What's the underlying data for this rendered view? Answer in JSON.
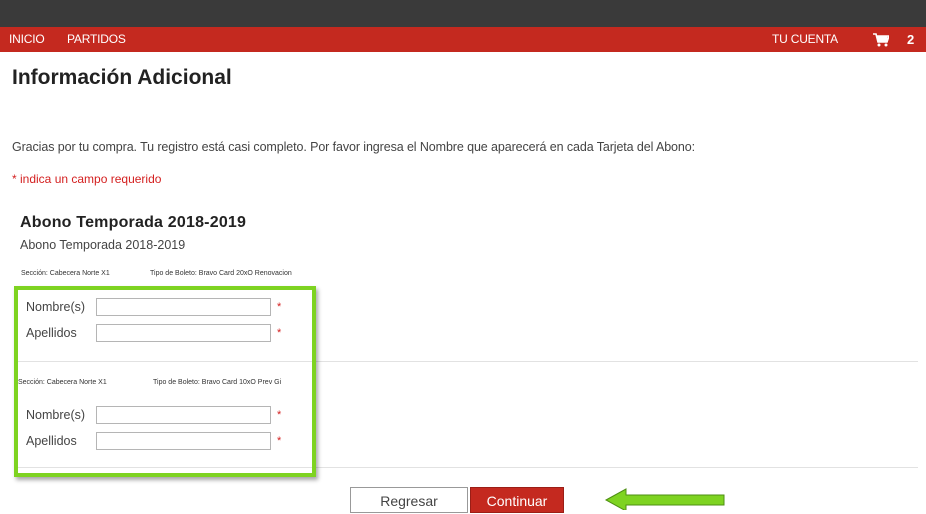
{
  "nav": {
    "inicio": "INICIO",
    "partidos": "PARTIDOS",
    "cuenta": "TU CUENTA",
    "cart_count": "2"
  },
  "page": {
    "title": "Información Adicional",
    "intro": "Gracias por tu compra. Tu registro está casi completo. Por favor ingresa el Nombre que aparecerá en cada Tarjeta del Abono:",
    "required_note": "* indica un campo requerido"
  },
  "product": {
    "title": "Abono Temporada 2018-2019",
    "subtitle": "Abono Temporada 2018-2019"
  },
  "cards": [
    {
      "seccion": "Sección: Cabecera Norte X1",
      "tipo": "Tipo de Boleto: Bravo Card 20xO Renovacion",
      "nombre_label": "Nombre(s)",
      "apellidos_label": "Apellidos",
      "nombre_value": "",
      "apellidos_value": ""
    },
    {
      "seccion": "Sección: Cabecera Norte X1",
      "tipo": "Tipo de Boleto: Bravo Card 10xO Prev Gi",
      "nombre_label": "Nombre(s)",
      "apellidos_label": "Apellidos",
      "nombre_value": "",
      "apellidos_value": ""
    }
  ],
  "required_mark": "*",
  "buttons": {
    "back": "Regresar",
    "continue": "Continuar"
  },
  "colors": {
    "nav_red": "#c4291f",
    "highlight_green": "#7ed321",
    "required_red": "#d42020"
  },
  "icons": {
    "cart": "shopping-cart-icon",
    "arrow": "arrow-left-icon"
  }
}
